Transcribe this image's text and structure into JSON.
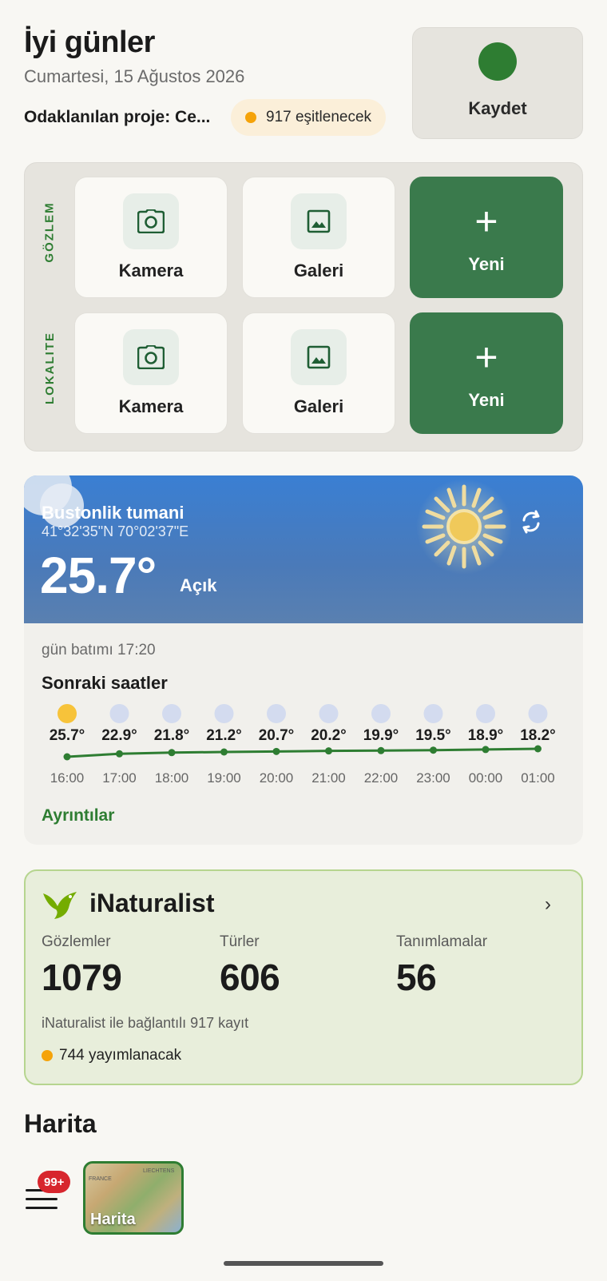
{
  "header": {
    "greeting": "İyi günler",
    "date": "Cumartesi, 15 Ağustos 2026",
    "project": "Odaklanılan proje: Ce...",
    "sync_chip": "917 eşitlenecek"
  },
  "save": {
    "label": "Kaydet",
    "color": "#2e7d32"
  },
  "capture": {
    "rows": [
      {
        "label": "GÖZLEM",
        "camera": "Kamera",
        "gallery": "Galeri",
        "new": "Yeni"
      },
      {
        "label": "LOKALITE",
        "camera": "Kamera",
        "gallery": "Galeri",
        "new": "Yeni"
      }
    ]
  },
  "weather": {
    "location": "Bustonlik tumani",
    "coordinates": "41°32'35\"N 70°02'37\"E",
    "temperature": "25.7°",
    "condition": "Açık",
    "sunset": "gün batımı 17:20",
    "next_hours_title": "Sonraki saatler",
    "details": "Ayrıntılar",
    "hours": [
      {
        "time": "16:00",
        "temp": "25.7°",
        "value": 25.7,
        "icon": "sun-icon"
      },
      {
        "time": "17:00",
        "temp": "22.9°",
        "value": 22.9,
        "icon": "moon-icon"
      },
      {
        "time": "18:00",
        "temp": "21.8°",
        "value": 21.8,
        "icon": "moon-icon"
      },
      {
        "time": "19:00",
        "temp": "21.2°",
        "value": 21.2,
        "icon": "moon-icon"
      },
      {
        "time": "20:00",
        "temp": "20.7°",
        "value": 20.7,
        "icon": "moon-icon"
      },
      {
        "time": "21:00",
        "temp": "20.2°",
        "value": 20.2,
        "icon": "moon-icon"
      },
      {
        "time": "22:00",
        "temp": "19.9°",
        "value": 19.9,
        "icon": "moon-icon"
      },
      {
        "time": "23:00",
        "temp": "19.5°",
        "value": 19.5,
        "icon": "moon-icon"
      },
      {
        "time": "00:00",
        "temp": "18.9°",
        "value": 18.9,
        "icon": "moon-icon"
      },
      {
        "time": "01:00",
        "temp": "18.2°",
        "value": 18.2,
        "icon": "moon-icon"
      }
    ]
  },
  "inaturalist": {
    "title": "iNaturalist",
    "stats": [
      {
        "label": "Gözlemler",
        "value": "1079"
      },
      {
        "label": "Türler",
        "value": "606"
      },
      {
        "label": "Tanımlamalar",
        "value": "56"
      }
    ],
    "linked": "iNaturalist ile bağlantılı 917 kayıt",
    "to_publish": "744 yayımlanacak"
  },
  "map": {
    "title": "Harita",
    "badge": "99+",
    "thumb_label": "Harita",
    "thumb_marks": [
      "FRANCE",
      "LIECHTENS"
    ]
  }
}
